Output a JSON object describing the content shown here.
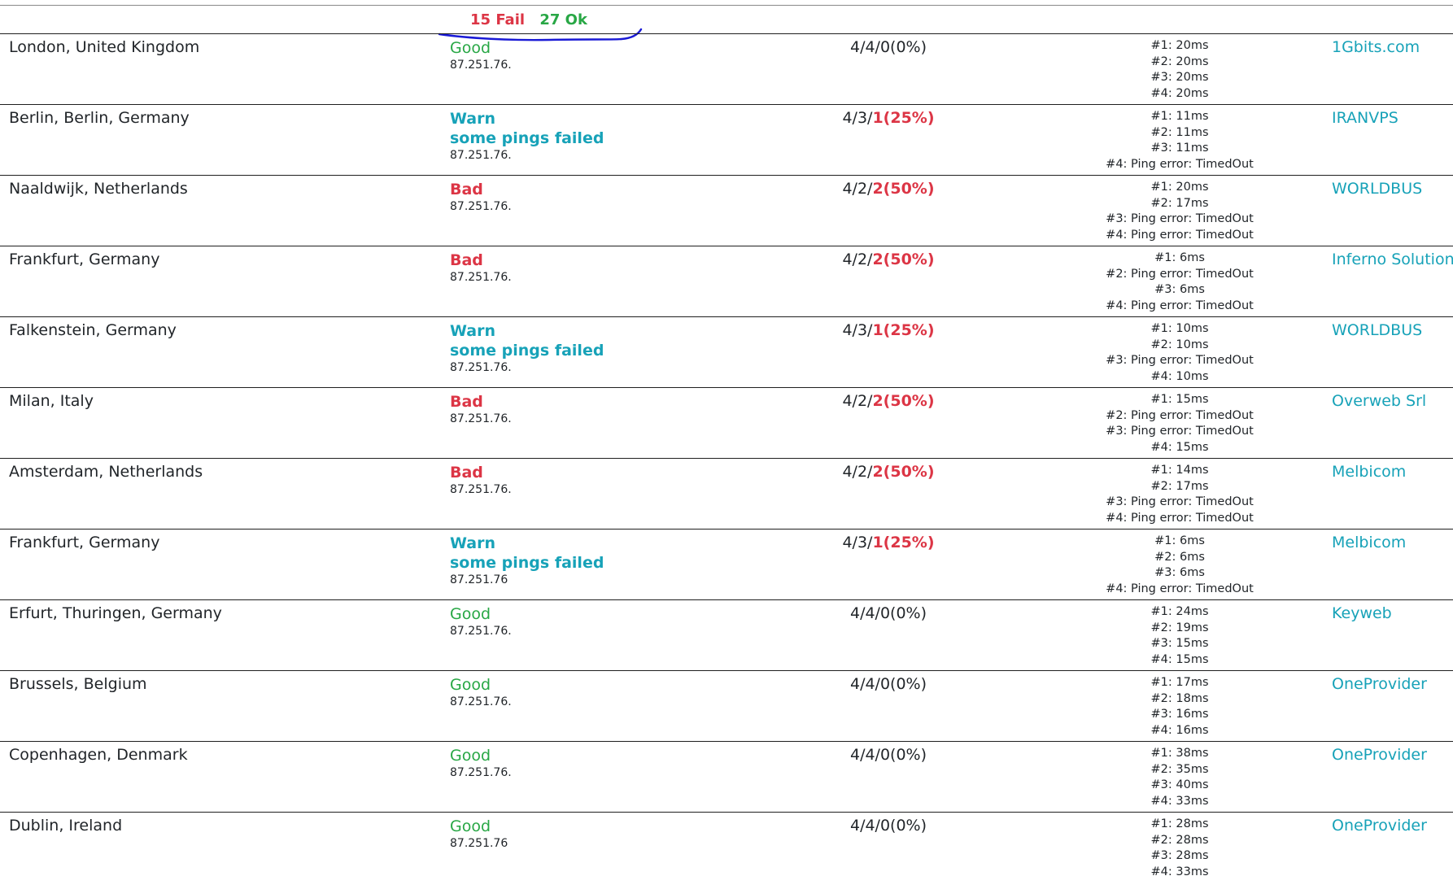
{
  "summary": {
    "fail": "15 Fail",
    "ok": "27 Ok"
  },
  "colors": {
    "good": "#28a745",
    "warn": "#17a2b8",
    "bad": "#dc3545",
    "link": "#17a2b8",
    "scribble": "#1a1ad6"
  },
  "rows": [
    {
      "location": "London, United Kingdom",
      "status": "Good",
      "status_type": "good",
      "status_sub": "",
      "ip": "87.251.76.",
      "ratio_prefix": "4/4/0(0%)",
      "ratio_loss": "",
      "pings": [
        "#1: 20ms",
        "#2: 20ms",
        "#3: 20ms",
        "#4: 20ms"
      ],
      "provider": "1Gbits.com"
    },
    {
      "location": "Berlin, Berlin, Germany",
      "status": "Warn",
      "status_type": "warn",
      "status_sub": "some pings failed",
      "ip": "87.251.76.",
      "ratio_prefix": "4/3/",
      "ratio_loss": "1(25%)",
      "pings": [
        "#1: 11ms",
        "#2: 11ms",
        "#3: 11ms",
        "#4: Ping error: TimedOut"
      ],
      "provider": "IRANVPS"
    },
    {
      "location": "Naaldwijk, Netherlands",
      "status": "Bad",
      "status_type": "bad",
      "status_sub": "",
      "ip": "87.251.76.",
      "ratio_prefix": "4/2/",
      "ratio_loss": "2(50%)",
      "pings": [
        "#1: 20ms",
        "#2: 17ms",
        "#3: Ping error: TimedOut",
        "#4: Ping error: TimedOut"
      ],
      "provider": "WORLDBUS"
    },
    {
      "location": "Frankfurt, Germany",
      "status": "Bad",
      "status_type": "bad",
      "status_sub": "",
      "ip": "87.251.76.",
      "ratio_prefix": "4/2/",
      "ratio_loss": "2(50%)",
      "pings": [
        "#1: 6ms",
        "#2: Ping error: TimedOut",
        "#3: 6ms",
        "#4: Ping error: TimedOut"
      ],
      "provider": "Inferno Solutions"
    },
    {
      "location": "Falkenstein, Germany",
      "status": "Warn",
      "status_type": "warn",
      "status_sub": "some pings failed",
      "ip": "87.251.76.",
      "ratio_prefix": "4/3/",
      "ratio_loss": "1(25%)",
      "pings": [
        "#1: 10ms",
        "#2: 10ms",
        "#3: Ping error: TimedOut",
        "#4: 10ms"
      ],
      "provider": "WORLDBUS"
    },
    {
      "location": "Milan, Italy",
      "status": "Bad",
      "status_type": "bad",
      "status_sub": "",
      "ip": "87.251.76.",
      "ratio_prefix": "4/2/",
      "ratio_loss": "2(50%)",
      "pings": [
        "#1: 15ms",
        "#2: Ping error: TimedOut",
        "#3: Ping error: TimedOut",
        "#4: 15ms"
      ],
      "provider": "Overweb Srl"
    },
    {
      "location": "Amsterdam, Netherlands",
      "status": "Bad",
      "status_type": "bad",
      "status_sub": "",
      "ip": "87.251.76.",
      "ratio_prefix": "4/2/",
      "ratio_loss": "2(50%)",
      "pings": [
        "#1: 14ms",
        "#2: 17ms",
        "#3: Ping error: TimedOut",
        "#4: Ping error: TimedOut"
      ],
      "provider": "Melbicom"
    },
    {
      "location": "Frankfurt, Germany",
      "status": "Warn",
      "status_type": "warn",
      "status_sub": "some pings failed",
      "ip": "87.251.76",
      "ratio_prefix": "4/3/",
      "ratio_loss": "1(25%)",
      "pings": [
        "#1: 6ms",
        "#2: 6ms",
        "#3: 6ms",
        "#4: Ping error: TimedOut"
      ],
      "provider": "Melbicom"
    },
    {
      "location": "Erfurt, Thuringen, Germany",
      "status": "Good",
      "status_type": "good",
      "status_sub": "",
      "ip": "87.251.76.",
      "ratio_prefix": "4/4/0(0%)",
      "ratio_loss": "",
      "pings": [
        "#1: 24ms",
        "#2: 19ms",
        "#3: 15ms",
        "#4: 15ms"
      ],
      "provider": "Keyweb"
    },
    {
      "location": "Brussels, Belgium",
      "status": "Good",
      "status_type": "good",
      "status_sub": "",
      "ip": "87.251.76.",
      "ratio_prefix": "4/4/0(0%)",
      "ratio_loss": "",
      "pings": [
        "#1: 17ms",
        "#2: 18ms",
        "#3: 16ms",
        "#4: 16ms"
      ],
      "provider": "OneProvider"
    },
    {
      "location": "Copenhagen, Denmark",
      "status": "Good",
      "status_type": "good",
      "status_sub": "",
      "ip": "87.251.76.",
      "ratio_prefix": "4/4/0(0%)",
      "ratio_loss": "",
      "pings": [
        "#1: 38ms",
        "#2: 35ms",
        "#3: 40ms",
        "#4: 33ms"
      ],
      "provider": "OneProvider"
    },
    {
      "location": "Dublin, Ireland",
      "status": "Good",
      "status_type": "good",
      "status_sub": "",
      "ip": "87.251.76",
      "ratio_prefix": "4/4/0(0%)",
      "ratio_loss": "",
      "pings": [
        "#1: 28ms",
        "#2: 28ms",
        "#3: 28ms",
        "#4: 33ms"
      ],
      "provider": "OneProvider"
    }
  ]
}
